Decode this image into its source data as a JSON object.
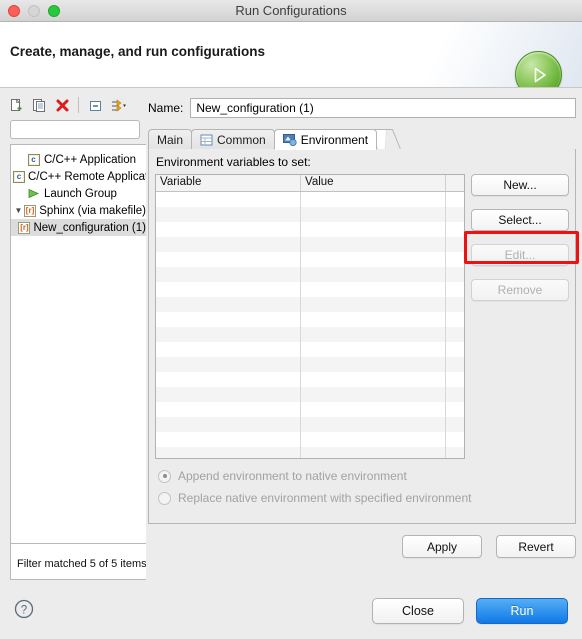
{
  "window": {
    "title": "Run Configurations",
    "traffic_lights": [
      "close-red",
      "minimize-grey",
      "zoom-green"
    ]
  },
  "banner": {
    "title": "Create, manage, and run configurations",
    "icon": "green-run-play-icon"
  },
  "left_panel": {
    "toolbar": [
      {
        "name": "new-configuration-icon",
        "glyph": "new-doc"
      },
      {
        "name": "duplicate-configuration-icon",
        "glyph": "copy-doc"
      },
      {
        "name": "delete-configuration-icon",
        "glyph": "red-x"
      },
      {
        "name": "collapse-all-icon",
        "glyph": "collapse"
      },
      {
        "name": "filter-menu-icon",
        "glyph": "filter-arrows"
      }
    ],
    "filter": {
      "value": "",
      "placeholder": ""
    },
    "tree": [
      {
        "label": "C/C++ Application",
        "icon": "c-file-icon",
        "indent": 1,
        "twisty": "",
        "selected": false
      },
      {
        "label": "C/C++ Remote Application",
        "icon": "c-file-icon",
        "indent": 1,
        "twisty": "",
        "selected": false
      },
      {
        "label": "Launch Group",
        "icon": "play-icon",
        "indent": 1,
        "twisty": "",
        "selected": false
      },
      {
        "label": "Sphinx (via makefile)",
        "icon": "r-file-icon",
        "indent": 0,
        "twisty": "▼",
        "selected": false
      },
      {
        "label": "New_configuration (1)",
        "icon": "r-file-icon",
        "indent": 2,
        "twisty": "",
        "selected": true
      }
    ],
    "status": "Filter matched 5 of 5 items"
  },
  "main": {
    "name_label": "Name:",
    "name_value": "New_configuration (1)",
    "tabs": [
      {
        "label": "Main",
        "icon": "",
        "active": false
      },
      {
        "label": "Common",
        "icon": "common-table-icon",
        "active": false
      },
      {
        "label": "Environment",
        "icon": "environment-icon",
        "active": true
      }
    ],
    "section_label": "Environment variables to set:",
    "table": {
      "columns": [
        "Variable",
        "Value",
        ""
      ],
      "rows": [],
      "empty_row_count": 18
    },
    "side_buttons": [
      {
        "label": "New...",
        "enabled": true,
        "highlighted": true
      },
      {
        "label": "Select...",
        "enabled": true,
        "highlighted": false
      },
      {
        "label": "Edit...",
        "enabled": false,
        "highlighted": false
      },
      {
        "label": "Remove",
        "enabled": false,
        "highlighted": false
      }
    ],
    "radios": [
      {
        "label": "Append environment to native environment",
        "selected": true,
        "enabled": false
      },
      {
        "label": "Replace native environment with specified environment",
        "selected": false,
        "enabled": false
      }
    ],
    "apply_label": "Apply",
    "revert_label": "Revert"
  },
  "footer": {
    "help_icon": "question-mark-icon",
    "close_label": "Close",
    "run_label": "Run"
  },
  "colors": {
    "highlight_red": "#ee1111",
    "primary_blue": "#1079e8",
    "run_green": "#5aa828",
    "window_bg": "#ececec"
  }
}
